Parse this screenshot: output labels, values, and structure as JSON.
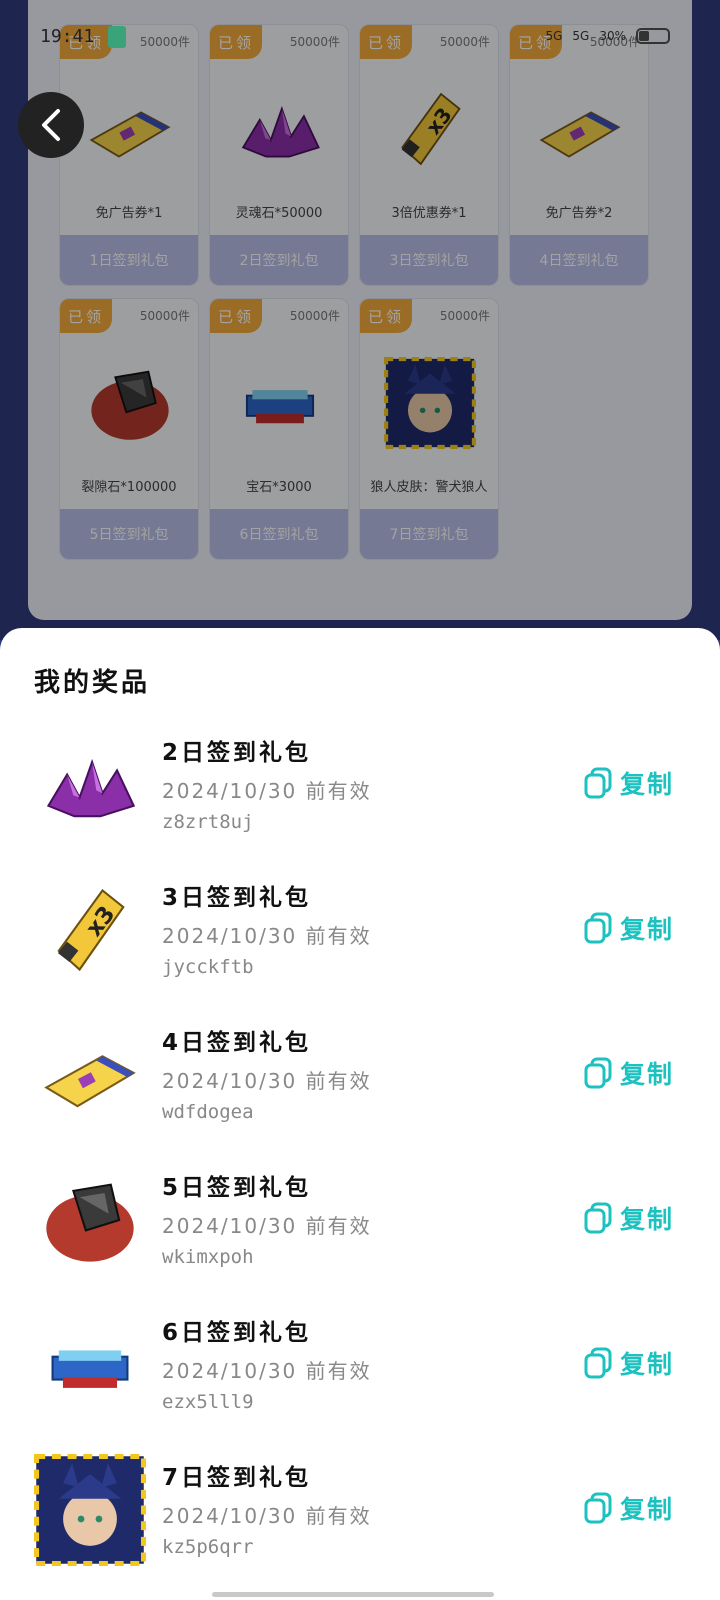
{
  "status_bar": {
    "time": "19:41",
    "network_left": "5G",
    "network_right": "5G",
    "battery_text": "30%"
  },
  "background_gifts": {
    "claimed_badge": "已领",
    "items": [
      {
        "name": "免广告券*1",
        "stock": "50000件",
        "day_label": "1日签到礼包",
        "icon": "ticket-icon"
      },
      {
        "name": "灵魂石*50000",
        "stock": "50000件",
        "day_label": "2日签到礼包",
        "icon": "crystal-icon"
      },
      {
        "name": "3倍优惠券*1",
        "stock": "50000件",
        "day_label": "3日签到礼包",
        "icon": "x3-ticket-icon"
      },
      {
        "name": "免广告券*2",
        "stock": "50000件",
        "day_label": "4日签到礼包",
        "icon": "ticket-icon"
      },
      {
        "name": "裂隙石*100000",
        "stock": "50000件",
        "day_label": "5日签到礼包",
        "icon": "rift-stone-icon"
      },
      {
        "name": "宝石*3000",
        "stock": "50000件",
        "day_label": "6日签到礼包",
        "icon": "gem-chest-icon"
      },
      {
        "name": "狼人皮肤：警犬狼人",
        "stock": "50000件",
        "day_label": "7日签到礼包",
        "icon": "werewolf-skin-icon"
      }
    ]
  },
  "sheet": {
    "title": "我的奖品",
    "copy_label": "复制",
    "prizes": [
      {
        "name": "2日签到礼包",
        "validity": "2024/10/30 前有效",
        "code": "z8zrt8uj",
        "icon": "crystal-icon"
      },
      {
        "name": "3日签到礼包",
        "validity": "2024/10/30 前有效",
        "code": "jycckftb",
        "icon": "x3-ticket-icon"
      },
      {
        "name": "4日签到礼包",
        "validity": "2024/10/30 前有效",
        "code": "wdfdogea",
        "icon": "ticket-icon"
      },
      {
        "name": "5日签到礼包",
        "validity": "2024/10/30 前有效",
        "code": "wkimxpoh",
        "icon": "rift-stone-icon"
      },
      {
        "name": "6日签到礼包",
        "validity": "2024/10/30 前有效",
        "code": "ezx5lll9",
        "icon": "gem-chest-icon"
      },
      {
        "name": "7日签到礼包",
        "validity": "2024/10/30 前有效",
        "code": "kz5p6qrr",
        "icon": "werewolf-skin-icon"
      }
    ]
  }
}
